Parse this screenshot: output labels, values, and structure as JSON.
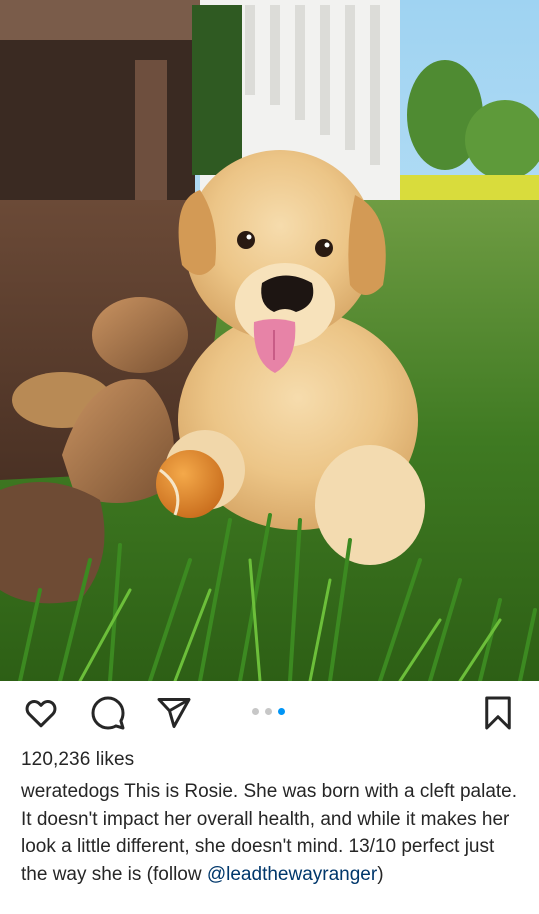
{
  "post": {
    "image_alt": "Golden retriever puppy lying on grass next to an orange tennis ball",
    "carousel": {
      "count": 3,
      "active_index": 2
    },
    "actions": {
      "like_icon": "heart-icon",
      "comment_icon": "comment-icon",
      "share_icon": "send-icon",
      "save_icon": "bookmark-icon"
    },
    "likes_text": "120,236 likes",
    "caption": {
      "username": "weratedogs",
      "text": "This is Rosie. She was born with a cleft palate. It doesn't impact her overall health, and while it makes her look a little different, she doesn't mind. 13/10 perfect just the way she is (follow",
      "mention": "@leadthewayranger",
      "closing": ")"
    }
  },
  "colors": {
    "text": "#262626",
    "mention": "#00376b",
    "dot_active": "#0095f6",
    "dot_inactive": "#c7c7c7"
  }
}
